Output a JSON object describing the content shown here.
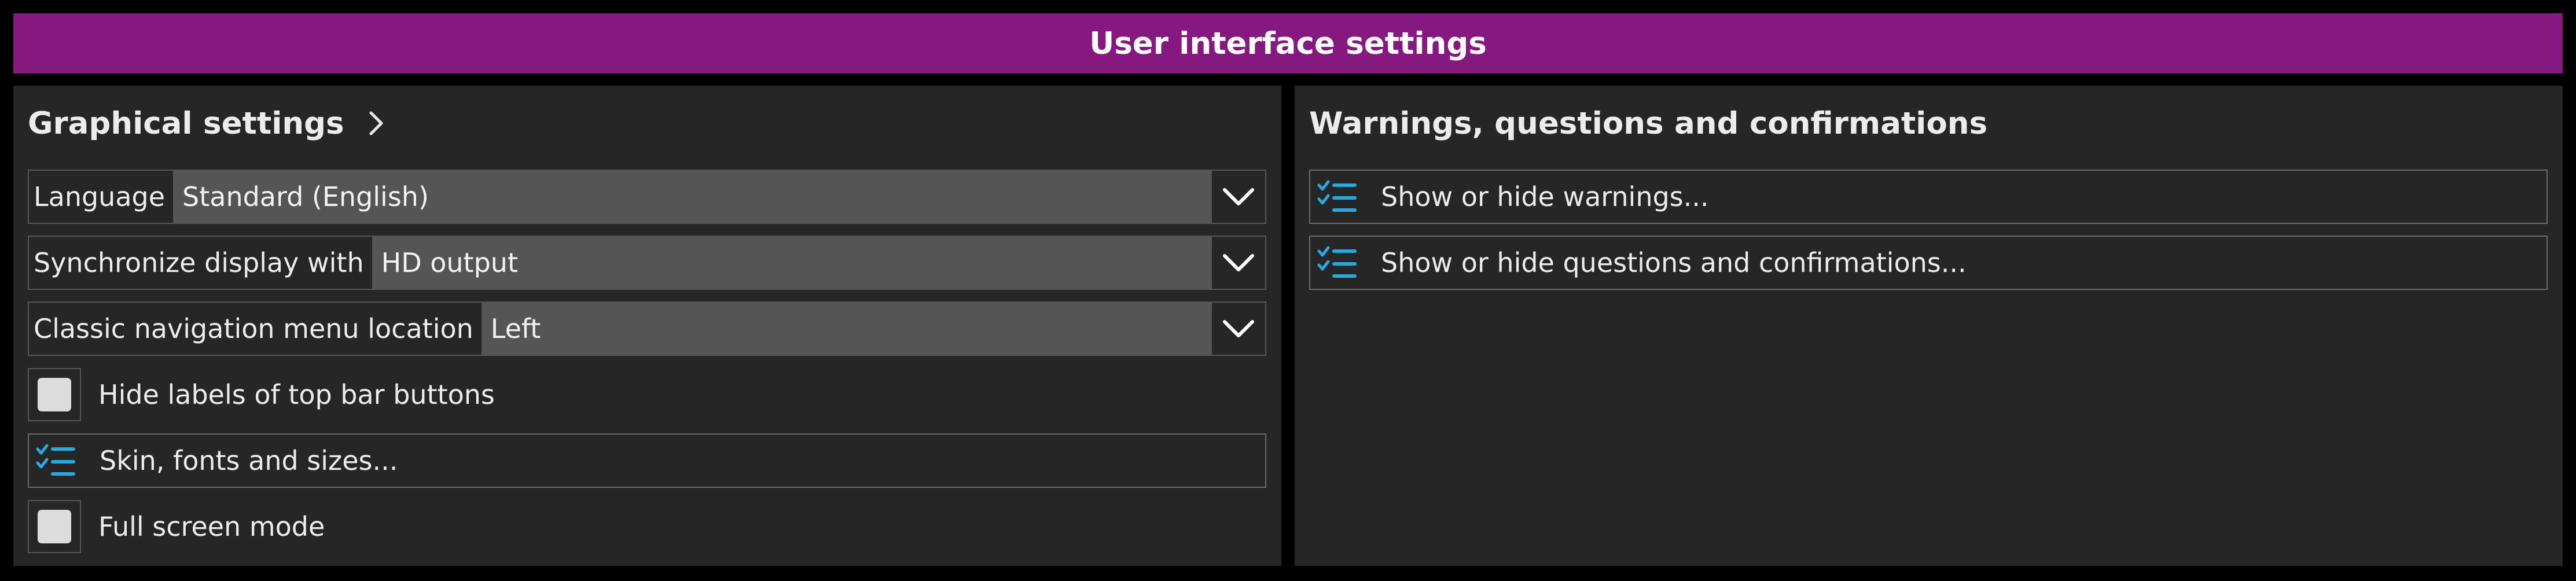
{
  "window": {
    "title": "User interface settings",
    "title_color": "#85197f",
    "accent_color": "#29a9df"
  },
  "graphical": {
    "title": "Graphical settings",
    "language": {
      "label": "Language",
      "value": "Standard (English)"
    },
    "sync_display": {
      "label": "Synchronize display with",
      "value": "HD output"
    },
    "nav_menu_location": {
      "label": "Classic navigation menu location",
      "value": "Left"
    },
    "hide_labels": {
      "label": "Hide labels of top bar buttons",
      "checked": false
    },
    "skin": {
      "label": "Skin, fonts and sizes..."
    },
    "full_screen": {
      "label": "Full screen mode",
      "checked": false
    }
  },
  "warnings": {
    "title": "Warnings, questions and confirmations",
    "show_warnings": {
      "label": "Show or hide warnings..."
    },
    "show_questions": {
      "label": "Show or hide questions and confirmations..."
    }
  }
}
